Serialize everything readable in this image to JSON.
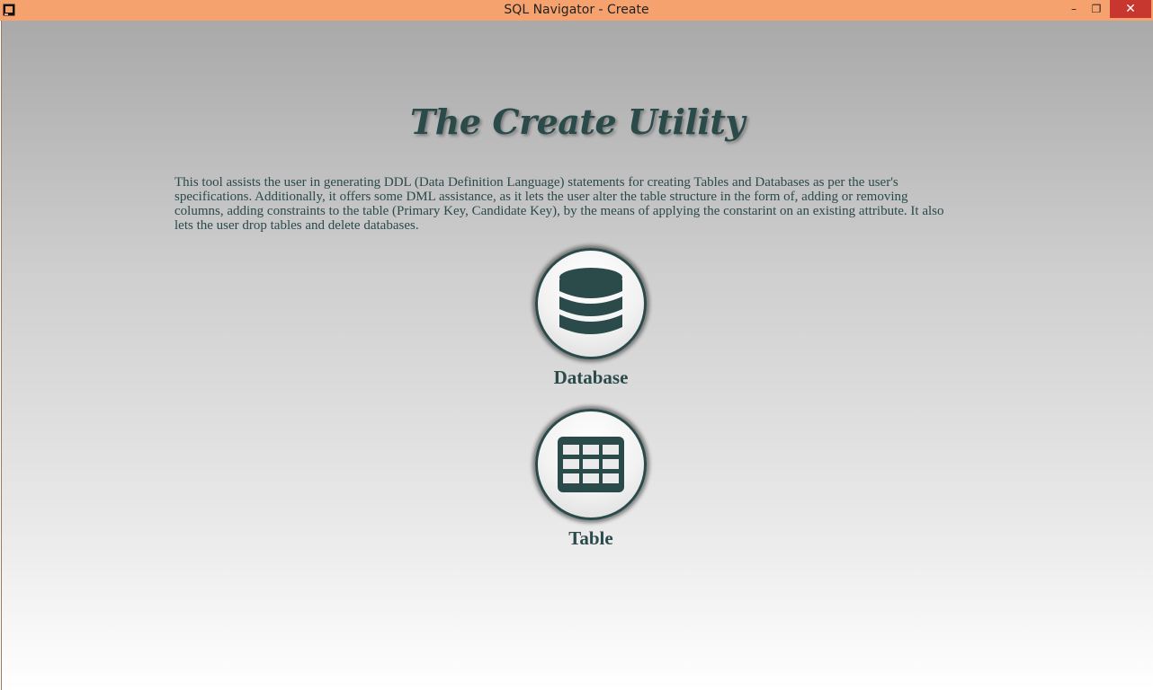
{
  "window": {
    "title": "SQL Navigator - Create",
    "minimize_glyph": "–",
    "restore_glyph": "❐",
    "close_glyph": "✕"
  },
  "page": {
    "title": "The Create Utility",
    "description": "This tool assists the user in generating DDL (Data Definition Language) statements for creating Tables and Databases as per the user's specifications. Additionally, it offers some DML assistance, as it lets the user alter the table structure in the form of, adding or removing columns, adding constraints to the table (Primary Key, Candidate Key), by the means of applying the constarint on an existing attribute. It also lets the user drop tables and delete databases."
  },
  "actions": {
    "database": {
      "label": "Database",
      "icon": "database-icon"
    },
    "table": {
      "label": "Table",
      "icon": "table-icon"
    }
  },
  "colors": {
    "titlebar": "#f6a26e",
    "accent": "#2b4a4a",
    "close_button": "#c7362f"
  }
}
